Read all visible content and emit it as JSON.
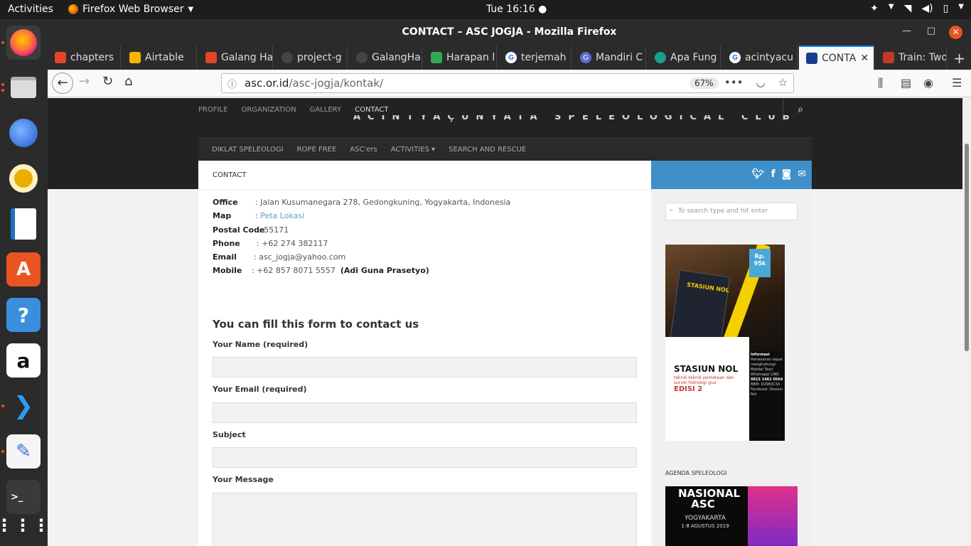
{
  "topbar": {
    "activities": "Activities",
    "app_name": "Firefox Web Browser",
    "clock": "Tue 16:16"
  },
  "dock": {
    "items": [
      "firefox",
      "files",
      "thunderbird",
      "rhythmbox",
      "libreoffice-impress",
      "ubuntu-software",
      "help",
      "amazon",
      "vscode",
      "text-editor",
      "terminal",
      "show-applications"
    ]
  },
  "window": {
    "title": "CONTACT – ASC JOGJA - Mozilla Firefox"
  },
  "tabs": [
    {
      "label": "chapters",
      "icon_color": "#e24329"
    },
    {
      "label": "Airtable",
      "icon_color": "#fcb400"
    },
    {
      "label": "Galang Ha",
      "icon_color": "#e24329"
    },
    {
      "label": "project-g",
      "icon_color": "#444444"
    },
    {
      "label": "GalangHa",
      "icon_color": "#444444"
    },
    {
      "label": "Harapan l",
      "icon_color": "#34a853"
    },
    {
      "label": "terjemah",
      "icon_color": "#4285f4"
    },
    {
      "label": "Mandiri C",
      "icon_color": "#5b6dcd"
    },
    {
      "label": "Apa Fung",
      "icon_color": "#1aa08a"
    },
    {
      "label": "acintyacu",
      "icon_color": "#4285f4"
    },
    {
      "label": "CONTA",
      "icon_color": "#1a3c8c"
    },
    {
      "label": "Train: Two",
      "icon_color": "#c0392b"
    }
  ],
  "urlbar": {
    "host": "asc.or.id",
    "path": "/asc-jogja/kontak/",
    "zoom": "67%"
  },
  "site": {
    "top_nav": [
      "PROFILE",
      "ORGANIZATION",
      "GALLERY",
      "CONTACT"
    ],
    "club_name": "ACINTYAÇUNYATA SPELEOLOGICAL CLUB",
    "sec_nav": [
      "DIKLAT SPELEOLOGI",
      "ROPE FREE",
      "ASC'ers",
      "ACTIVITIES ▾",
      "SEARCH AND RESCUE"
    ],
    "breadcrumb": "CONTACT",
    "contact": {
      "office_label": "Office",
      "office_value": ": Jalan Kusumanegara 278, Gedongkuning, Yogyakarta, Indonesia",
      "map_label": "Map",
      "map_sep": ":",
      "map_link": "Peta Lokasi",
      "postal_label": "Postal Code",
      "postal_value": ": 55171",
      "phone_label": "Phone",
      "phone_value": ": +62 274 382117",
      "email_label": "Email",
      "email_value": ": asc_jogja@yahoo.com",
      "mobile_label": "Mobile",
      "mobile_value": ": +62 857 8071 5557",
      "mobile_name": "(Adi Guna Prasetyo)"
    },
    "form": {
      "title": "You can fill this form to contact us",
      "name_label": "Your Name (required)",
      "email_label": "Your Email (required)",
      "subject_label": "Subject",
      "message_label": "Your Message"
    },
    "sidebar": {
      "search_placeholder": "To search type and hit enter",
      "poster": {
        "price_prefix": "Rp.",
        "price": "95k",
        "book_title": "STASIUN NOL",
        "title": "STASIUN NOL",
        "subtitle": "teknik-teknik pemetaan dan survei hidrologi gua",
        "edition": "EDISI 2",
        "info_heading": "Informasi",
        "info_text": "Pemesanan dapat menghubungi: Mobile/ Text/ Whatsapp/ LINE:",
        "info_phone": "0813 1462 0564",
        "info_bbm": "BBM: D29B3C34",
        "info_fb": "Facebook: Stasiun Nol"
      },
      "agenda_title": "AGENDA SPELEOLOGI",
      "agenda": {
        "headline": "NASIONAL ASC",
        "city": "YOGYAKARTA",
        "date": "1-8 AGUSTUS 2019"
      }
    }
  }
}
